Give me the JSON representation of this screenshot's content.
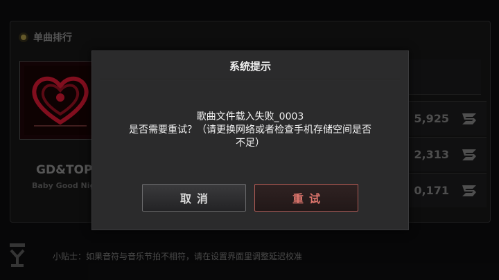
{
  "background": {
    "ranking_title": "单曲排行",
    "album": {
      "artist": "GD&TOP",
      "song": "Baby Good Nig"
    },
    "scores": [
      "5,925",
      "2,313",
      "0,171"
    ],
    "tip": "小贴士：如果音符与音乐节拍不相符，请在设置界面里调整延迟校准"
  },
  "dialog": {
    "title": "系统提示",
    "message_line1": "歌曲文件载入失败_0003",
    "message_line2": "是否需要重试？（请更换网络或者检查手机存储空间是否",
    "message_line3": "不足）",
    "cancel_label": "取消",
    "retry_label": "重试"
  },
  "colors": {
    "dialog_bg": "#2b2b2c",
    "retry_accent": "#e0776e",
    "album_red": "#b3142a"
  },
  "icons": [
    "s-logo-icon",
    "heart-emblem-icon",
    "yg-logo-icon"
  ]
}
